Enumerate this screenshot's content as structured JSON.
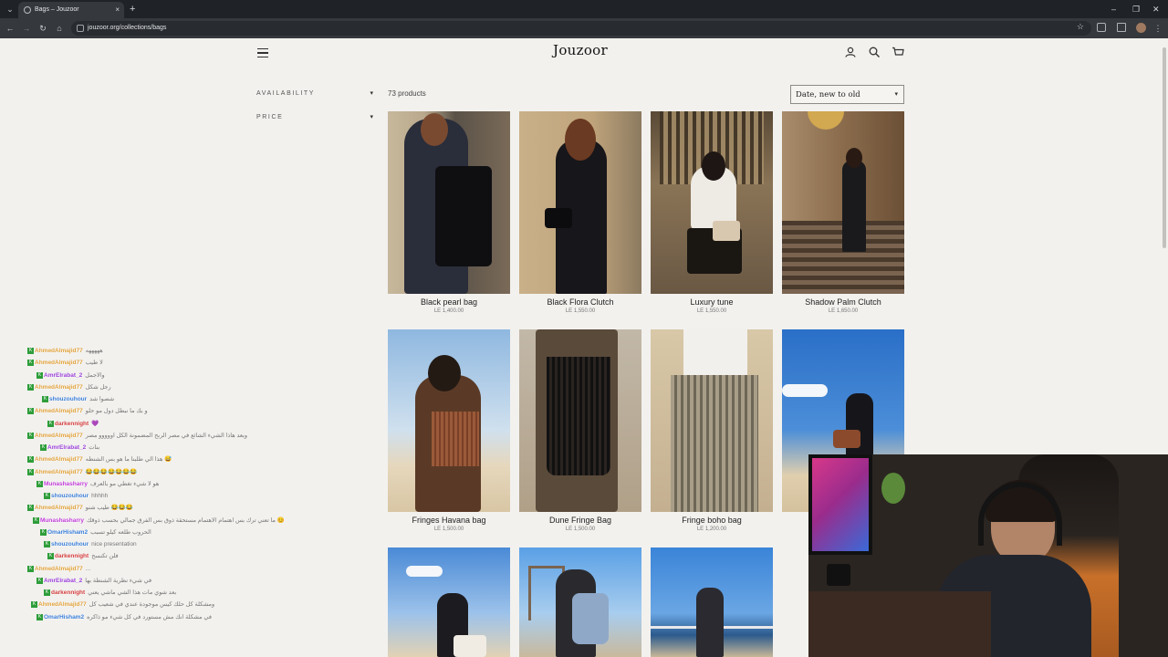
{
  "browser": {
    "tab_title": "Bags – Jouzoor",
    "url": "jouzoor.org/collections/bags",
    "new_tab_label": "+",
    "close_tab_label": "×",
    "minimize_label": "–",
    "restore_label": "❐",
    "close_window_label": "✕",
    "back_label": "←",
    "forward_label": "→",
    "reload_label": "↻",
    "home_label": "⌂",
    "star_label": "☆"
  },
  "store": {
    "logo": "Jouzoor",
    "filters": [
      {
        "label": "AVAILABILITY"
      },
      {
        "label": "PRICE"
      }
    ],
    "product_count": "73 products",
    "sort_value": "Date, new to old",
    "products": [
      {
        "name": "Black pearl bag",
        "price": "LE 1,400.00"
      },
      {
        "name": "Black Flora Clutch",
        "price": "LE 1,550.00"
      },
      {
        "name": "Luxury tune",
        "price": "LE 1,550.00"
      },
      {
        "name": "Shadow Palm Clutch",
        "price": "LE 1,650.00"
      },
      {
        "name": "Fringes Havana bag",
        "price": "LE 1,500.00"
      },
      {
        "name": "Dune Fringe Bag",
        "price": "LE 1,500.00"
      },
      {
        "name": "Fringe boho bag",
        "price": "LE 1,200.00"
      },
      {
        "name": "",
        "price": ""
      },
      {
        "name": "",
        "price": ""
      },
      {
        "name": "",
        "price": ""
      },
      {
        "name": "",
        "price": ""
      }
    ]
  },
  "chat": {
    "messages": [
      {
        "user": "AhmedAlmajid77",
        "text": "هههههه",
        "color": "#e0a13a"
      },
      {
        "user": "AhmedAlmajid77",
        "text": "لا طيب",
        "color": "#e0a13a"
      },
      {
        "user": "AmrElrabat_2",
        "text": "والاجمل",
        "color": "#9a3ed8"
      },
      {
        "user": "AhmedAlmajid77",
        "text": "رجل شكل",
        "color": "#e0a13a"
      },
      {
        "user": "shouzouhour",
        "text": "شصوا شد",
        "color": "#3a7dd8"
      },
      {
        "user": "AhmedAlmajid77",
        "text": "و بك ما نبطل دول مو حلو",
        "color": "#e0a13a"
      },
      {
        "user": "darkennight",
        "text": "💜",
        "color": "#d23b3b"
      },
      {
        "user": "AhmedAlmajid77",
        "text": "وبعد هاذا الشيء الشائع في مصر الربح المضمونة الكل اووووو مصر",
        "color": "#e0a13a"
      },
      {
        "user": "AmrElrabat_2",
        "text": "بنات",
        "color": "#9a3ed8"
      },
      {
        "user": "AhmedAlmajid77",
        "text": "هذا الي طلبنا ما هو بس الشنطه 😅",
        "color": "#e0a13a"
      },
      {
        "user": "AhmedAlmajid77",
        "text": "😂😂😂😂😂😂😂",
        "color": "#e0a13a"
      },
      {
        "user": "Munashasharry",
        "text": "هو لا شيء تغطي مو بالعرف",
        "color": "#c13ad8"
      },
      {
        "user": "shouzouhour",
        "text": "hhhhh",
        "color": "#3a7dd8"
      },
      {
        "user": "AhmedAlmajid77",
        "text": "طيب شنو 😂😂😂",
        "color": "#e0a13a"
      },
      {
        "user": "Munashasharry",
        "text": "ما تعني ترك بس اهتمام الاهتمام مستحقة ذوق بس الفرق جمالي بحسب ذوقك 😊",
        "color": "#c13ad8"
      },
      {
        "user": "OmarHisham2",
        "text": "الحروب طلعه كيلو تسبب",
        "color": "#3a7dd8"
      },
      {
        "user": "shouzouhour",
        "text": "nice presentation",
        "color": "#3a7dd8"
      },
      {
        "user": "darkennight",
        "text": "فلن تكنسح",
        "color": "#d23b3b"
      },
      {
        "user": "AhmedAlmajid77",
        "text": "...",
        "color": "#e0a13a"
      },
      {
        "user": "AmrElrabat_2",
        "text": "في شيء نظرية الشنطة بها",
        "color": "#9a3ed8"
      },
      {
        "user": "darkennight",
        "text": "بعد شوي مات هذا الشي ماشي يعني",
        "color": "#d23b3b"
      },
      {
        "user": "AhmedAlmajid77",
        "text": "ومشكلة كل حلك كيس موجودة عندي في شعيب كل",
        "color": "#e0a13a"
      },
      {
        "user": "OmarHisham2",
        "text": "في مشكلة انك مش مستورد في كل شيء مو ذاكره",
        "color": "#3a7dd8"
      }
    ]
  },
  "colors": {
    "page_bg": "#f2f1ee",
    "chrome_bg": "#1f2226",
    "mod_badge": "#2e9d3a"
  }
}
